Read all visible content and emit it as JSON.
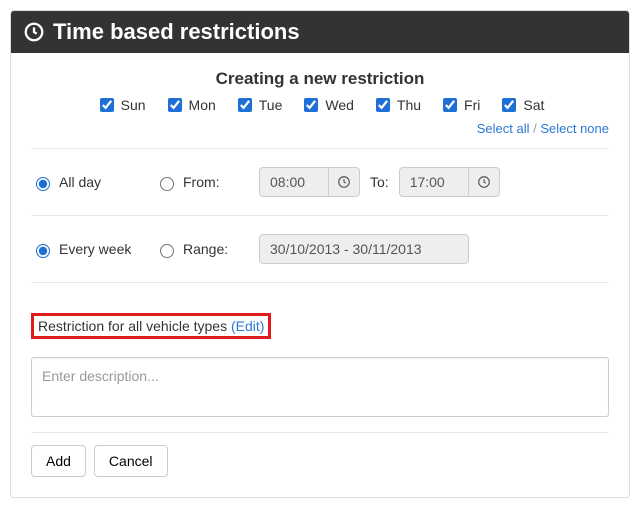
{
  "header": {
    "title": "Time based restrictions"
  },
  "subtitle": "Creating a new restriction",
  "days": {
    "items": [
      {
        "label": "Sun",
        "checked": true
      },
      {
        "label": "Mon",
        "checked": true
      },
      {
        "label": "Tue",
        "checked": true
      },
      {
        "label": "Wed",
        "checked": true
      },
      {
        "label": "Thu",
        "checked": true
      },
      {
        "label": "Fri",
        "checked": true
      },
      {
        "label": "Sat",
        "checked": true
      }
    ],
    "select_all": "Select all",
    "separator": " / ",
    "select_none": "Select none"
  },
  "time": {
    "all_day_label": "All day",
    "from_label": "From:",
    "from_value": "08:00",
    "to_label": "To:",
    "to_value": "17:00",
    "selected": "all_day"
  },
  "recur": {
    "every_week_label": "Every week",
    "range_label": "Range:",
    "range_value": "30/10/2013 - 30/11/2013",
    "selected": "every_week"
  },
  "vehicle": {
    "text": "Restriction for all vehicle types ",
    "edit": "(Edit)"
  },
  "description": {
    "placeholder": "Enter description..."
  },
  "buttons": {
    "add": "Add",
    "cancel": "Cancel"
  }
}
